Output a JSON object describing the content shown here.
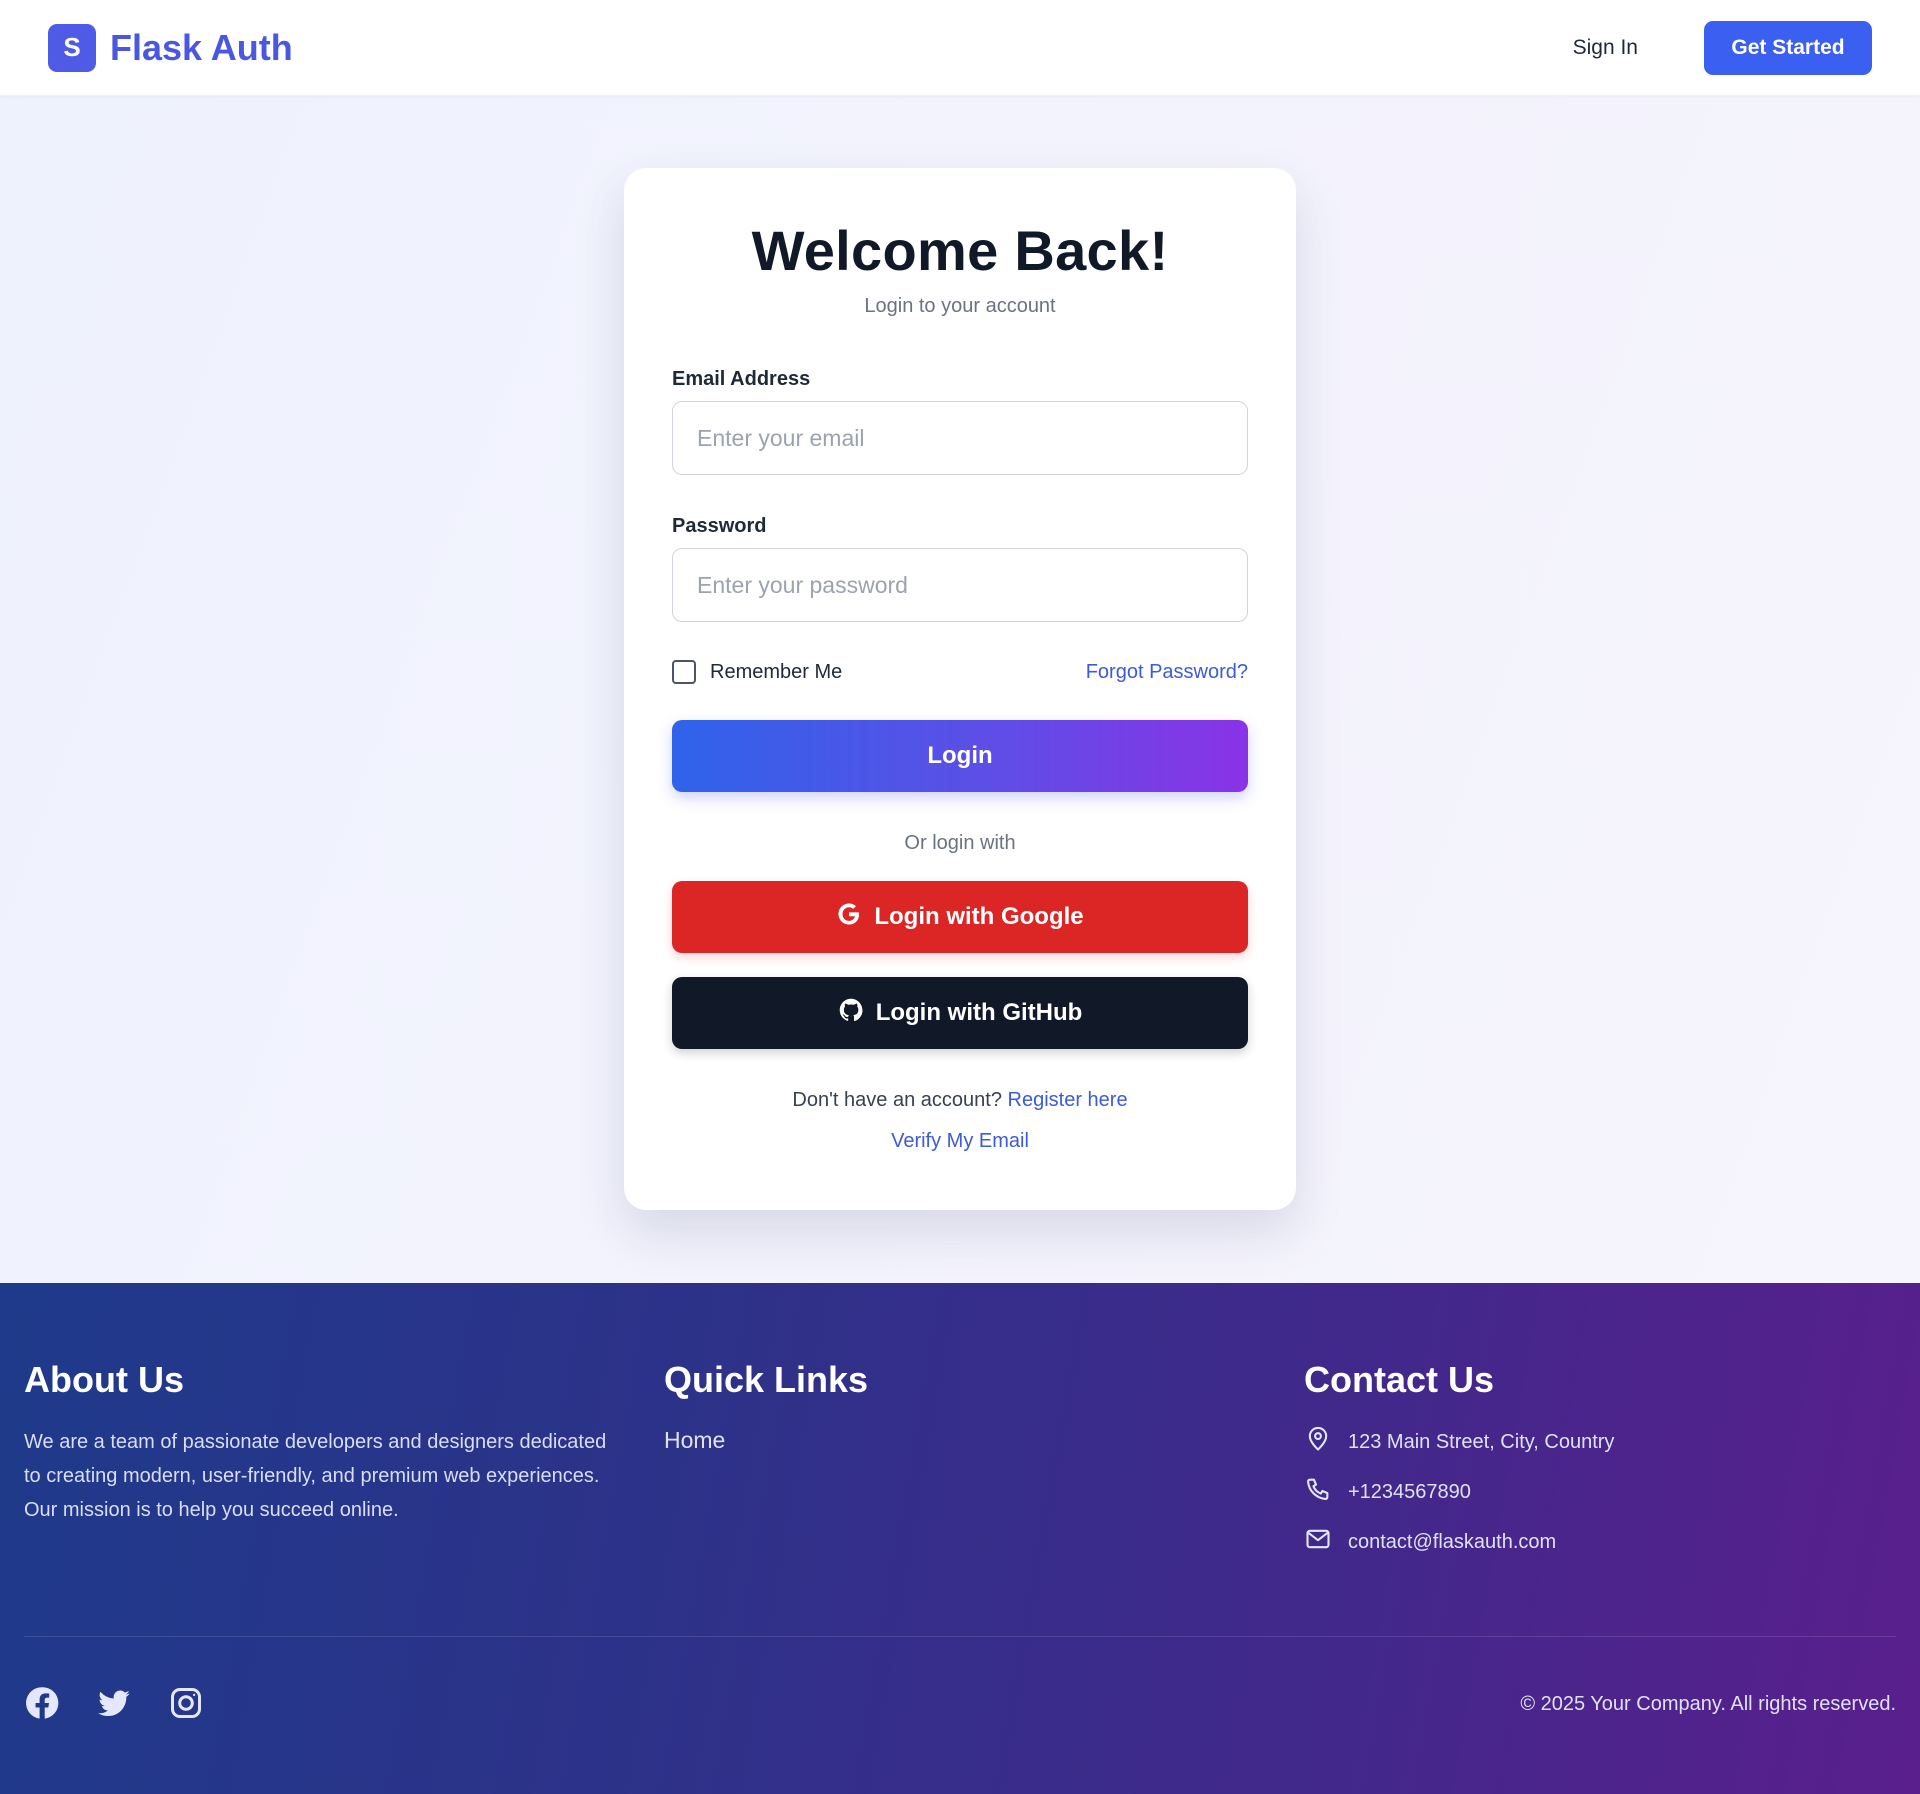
{
  "header": {
    "badge": "S",
    "brand": "Flask Auth",
    "signin": "Sign In",
    "cta": "Get Started"
  },
  "card": {
    "title": "Welcome Back!",
    "subtitle": "Login to your account",
    "email_label": "Email Address",
    "email_placeholder": "Enter your email",
    "email_value": "",
    "password_label": "Password",
    "password_placeholder": "Enter your password",
    "password_value": "",
    "remember": "Remember Me",
    "forgot": "Forgot Password?",
    "login": "Login",
    "divider": "Or login with",
    "google": "Login with Google",
    "github": "Login with GitHub",
    "register_prompt": "Don't have an account?",
    "register_link": "Register here",
    "verify": "Verify My Email"
  },
  "footer": {
    "about_title": "About Us",
    "about_text": "We are a team of passionate developers and designers dedicated to creating modern, user-friendly, and premium web experiences. Our mission is to help you succeed online.",
    "links_title": "Quick Links",
    "links": [
      {
        "label": "Home"
      }
    ],
    "contact_title": "Contact Us",
    "address": "123 Main Street, City, Country",
    "phone": "+1234567890",
    "email": "contact@flaskauth.com",
    "copyright": "© 2025 Your Company. All rights reserved."
  },
  "icons": {
    "brand": "logo-badge",
    "google": "google-icon",
    "github": "github-icon",
    "address": "location-pin-icon",
    "phone": "phone-icon",
    "email": "mail-icon",
    "socials": [
      "facebook-icon",
      "twitter-icon",
      "instagram-icon"
    ]
  },
  "colors": {
    "brand": "#4a57e0",
    "cta": "#3b5ff0",
    "google": "#dc2626",
    "github": "#111827",
    "link": "#3b5bd9"
  }
}
